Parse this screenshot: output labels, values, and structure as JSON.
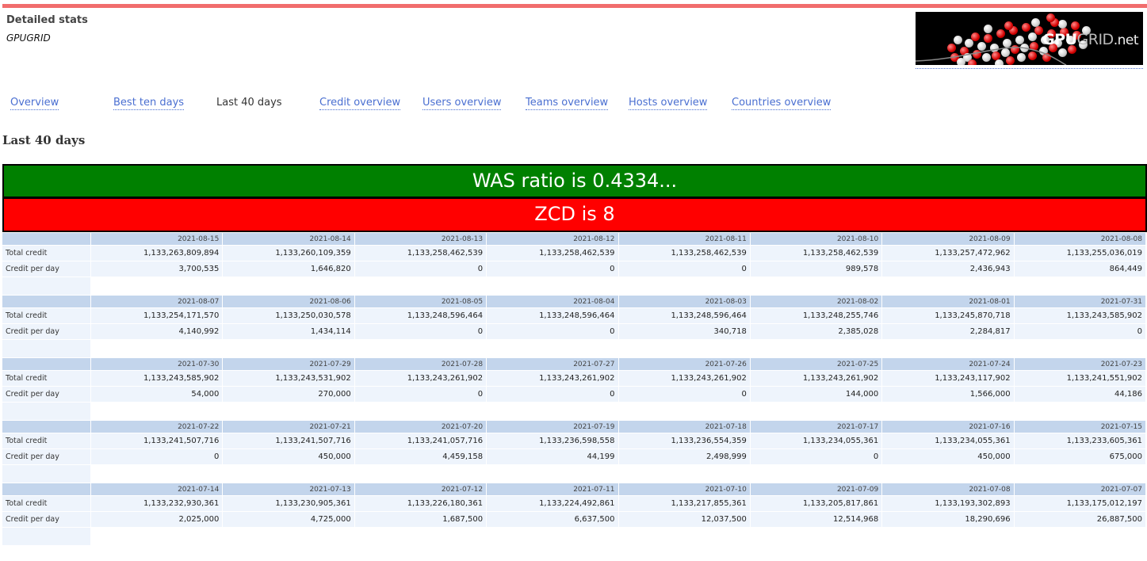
{
  "header": {
    "title": "Detailed stats",
    "subtitle": "GPUGRID",
    "logo": {
      "bold": "GPU",
      "thin": "GRID",
      "suffix": ".net"
    }
  },
  "nav": {
    "items": [
      {
        "label": "Overview",
        "active": false
      },
      {
        "label": "Best ten days",
        "active": false
      },
      {
        "label": "Last 40 days",
        "active": true
      },
      {
        "label": "Credit overview",
        "active": false
      },
      {
        "label": "Users overview",
        "active": false
      },
      {
        "label": "Teams overview",
        "active": false
      },
      {
        "label": "Hosts overview",
        "active": false
      },
      {
        "label": "Countries overview",
        "active": false
      }
    ]
  },
  "page": {
    "section_title": "Last 40 days",
    "was_banner": "WAS ratio is 0.4334...",
    "zcd_banner": "ZCD is 8",
    "colors": {
      "was": "#008000",
      "zcd": "#ff0000",
      "top_bar": "#f16d6d",
      "link": "#4a6fd1"
    }
  },
  "table": {
    "row_labels": {
      "total": "Total credit",
      "per_day": "Credit per day"
    },
    "blocks": [
      {
        "dates": [
          "2021-08-15",
          "2021-08-14",
          "2021-08-13",
          "2021-08-12",
          "2021-08-11",
          "2021-08-10",
          "2021-08-09",
          "2021-08-08"
        ],
        "total": [
          "1,133,263,809,894",
          "1,133,260,109,359",
          "1,133,258,462,539",
          "1,133,258,462,539",
          "1,133,258,462,539",
          "1,133,258,462,539",
          "1,133,257,472,962",
          "1,133,255,036,019"
        ],
        "per_day": [
          "3,700,535",
          "1,646,820",
          "0",
          "0",
          "0",
          "989,578",
          "2,436,943",
          "864,449"
        ]
      },
      {
        "dates": [
          "2021-08-07",
          "2021-08-06",
          "2021-08-05",
          "2021-08-04",
          "2021-08-03",
          "2021-08-02",
          "2021-08-01",
          "2021-07-31"
        ],
        "total": [
          "1,133,254,171,570",
          "1,133,250,030,578",
          "1,133,248,596,464",
          "1,133,248,596,464",
          "1,133,248,596,464",
          "1,133,248,255,746",
          "1,133,245,870,718",
          "1,133,243,585,902"
        ],
        "per_day": [
          "4,140,992",
          "1,434,114",
          "0",
          "0",
          "340,718",
          "2,385,028",
          "2,284,817",
          "0"
        ]
      },
      {
        "dates": [
          "2021-07-30",
          "2021-07-29",
          "2021-07-28",
          "2021-07-27",
          "2021-07-26",
          "2021-07-25",
          "2021-07-24",
          "2021-07-23"
        ],
        "total": [
          "1,133,243,585,902",
          "1,133,243,531,902",
          "1,133,243,261,902",
          "1,133,243,261,902",
          "1,133,243,261,902",
          "1,133,243,261,902",
          "1,133,243,117,902",
          "1,133,241,551,902"
        ],
        "per_day": [
          "54,000",
          "270,000",
          "0",
          "0",
          "0",
          "144,000",
          "1,566,000",
          "44,186"
        ]
      },
      {
        "dates": [
          "2021-07-22",
          "2021-07-21",
          "2021-07-20",
          "2021-07-19",
          "2021-07-18",
          "2021-07-17",
          "2021-07-16",
          "2021-07-15"
        ],
        "total": [
          "1,133,241,507,716",
          "1,133,241,507,716",
          "1,133,241,057,716",
          "1,133,236,598,558",
          "1,133,236,554,359",
          "1,133,234,055,361",
          "1,133,234,055,361",
          "1,133,233,605,361"
        ],
        "per_day": [
          "0",
          "450,000",
          "4,459,158",
          "44,199",
          "2,498,999",
          "0",
          "450,000",
          "675,000"
        ]
      },
      {
        "dates": [
          "2021-07-14",
          "2021-07-13",
          "2021-07-12",
          "2021-07-11",
          "2021-07-10",
          "2021-07-09",
          "2021-07-08",
          "2021-07-07"
        ],
        "total": [
          "1,133,232,930,361",
          "1,133,230,905,361",
          "1,133,226,180,361",
          "1,133,224,492,861",
          "1,133,217,855,361",
          "1,133,205,817,861",
          "1,133,193,302,893",
          "1,133,175,012,197"
        ],
        "per_day": [
          "2,025,000",
          "4,725,000",
          "1,687,500",
          "6,637,500",
          "12,037,500",
          "12,514,968",
          "18,290,696",
          "26,887,500"
        ]
      }
    ]
  }
}
